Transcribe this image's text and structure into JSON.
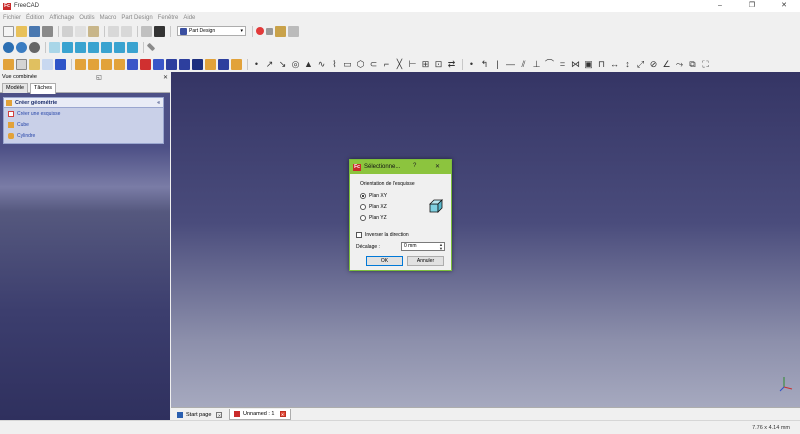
{
  "window": {
    "title": "FreeCAD",
    "logo_text": "Fc",
    "minimize": "–",
    "maximize": "❐",
    "close": "✕"
  },
  "menu": [
    "Fichier",
    "Édition",
    "Affichage",
    "Outils",
    "Macro",
    "Part Design",
    "Fenêtre",
    "Aide"
  ],
  "toolbar": {
    "workbench_selector": {
      "value": "Part Design"
    }
  },
  "combo_view": {
    "title": "Vue combinée",
    "tabs": [
      "Modèle",
      "Tâches"
    ],
    "active_tab": "Tâches",
    "task_panel": {
      "title": "Créer géométrie",
      "items": [
        "Créer une esquisse",
        "Cube",
        "Cylindre"
      ]
    }
  },
  "document_tabs": [
    {
      "label": "Start page"
    },
    {
      "label": "Unnamed : 1"
    }
  ],
  "status": {
    "dimensions": "7.76 x 4.14 mm"
  },
  "dialog": {
    "title": "Sélectionne...",
    "help": "?",
    "close": "✕",
    "group_label": "Orientation de l'esquisse",
    "options": [
      "Plan XY",
      "Plan XZ",
      "Plan YZ"
    ],
    "selected_option": "Plan XY",
    "invert_label": "Inverser la direction",
    "invert_checked": false,
    "offset_label": "Décalage :",
    "offset_value": "0 mm",
    "ok_label": "OK",
    "cancel_label": "Annuler"
  },
  "colors": {
    "dialog_title_bar": "#8cc43e",
    "background_top": "#353565",
    "background_bottom": "#a6a9bf",
    "task_panel": "#c9d0e8"
  }
}
